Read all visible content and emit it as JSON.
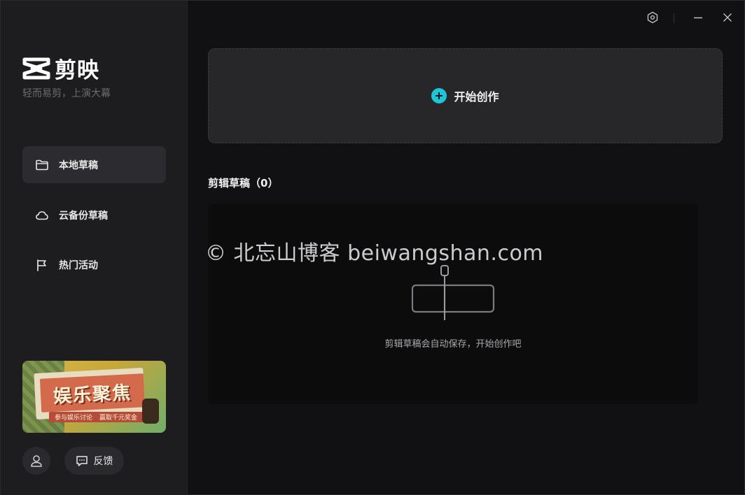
{
  "app": {
    "logo_text": "剪映",
    "slogan": "轻而易剪，上演大幕"
  },
  "sidebar": {
    "items": [
      {
        "label": "本地草稿",
        "icon": "folder-icon",
        "active": true
      },
      {
        "label": "云备份草稿",
        "icon": "cloud-icon",
        "active": false
      },
      {
        "label": "热门活动",
        "icon": "flag-icon",
        "active": false
      }
    ],
    "banner": {
      "title": "娱乐聚焦",
      "sub_left": "参与娱乐讨论",
      "sub_right": "赢取千元奖金"
    },
    "feedback_label": "反馈"
  },
  "main": {
    "create_label": "开始创作",
    "section_title": "剪辑草稿（0）",
    "empty_text": "剪辑草稿会自动保存，开始创作吧"
  },
  "watermark": "© 北忘山博客 beiwangshan.com",
  "colors": {
    "accent": "#1fc5d6",
    "sidebar_bg": "#1d1d20",
    "main_bg": "#111113"
  }
}
